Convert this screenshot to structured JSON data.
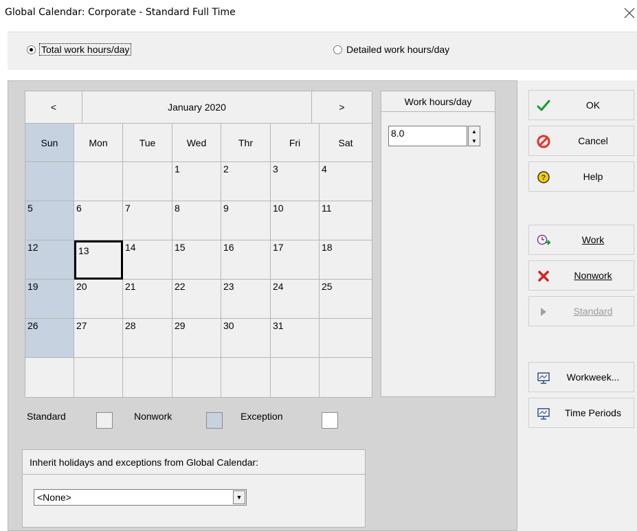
{
  "window": {
    "title": "Global Calendar: Corporate - Standard Full Time"
  },
  "mode": {
    "total_label": "Total work hours/day",
    "detailed_label": "Detailed work hours/day",
    "selected": "total"
  },
  "calendar": {
    "month_label": "January 2020",
    "prev_label": "<",
    "next_label": ">",
    "weekdays": [
      "Sun",
      "Mon",
      "Tue",
      "Wed",
      "Thr",
      "Fri",
      "Sat"
    ],
    "weeks": [
      [
        "",
        "",
        "",
        "1",
        "2",
        "3",
        "4"
      ],
      [
        "5",
        "6",
        "7",
        "8",
        "9",
        "10",
        "11"
      ],
      [
        "12",
        "13",
        "14",
        "15",
        "16",
        "17",
        "18"
      ],
      [
        "19",
        "20",
        "21",
        "22",
        "23",
        "24",
        "25"
      ],
      [
        "26",
        "27",
        "28",
        "29",
        "30",
        "31",
        ""
      ],
      [
        "",
        "",
        "",
        "",
        "",
        "",
        ""
      ]
    ],
    "selected_day": "13"
  },
  "work_hours": {
    "header": "Work hours/day",
    "value": "8.0"
  },
  "legend": {
    "standard": "Standard",
    "nonwork": "Nonwork",
    "exception": "Exception"
  },
  "inherit": {
    "label": "Inherit holidays and exceptions from Global Calendar:",
    "value": "<None>"
  },
  "buttons": {
    "ok": "OK",
    "cancel": "Cancel",
    "help": "Help",
    "work": "Work",
    "nonwork": "Nonwork",
    "standard": "Standard",
    "workweek": "Workweek...",
    "time_periods": "Time Periods"
  },
  "colors": {
    "sunday_fill": "#c6d2df",
    "panel_bg": "#d4d4d4",
    "control_bg": "#f0f0f0",
    "ok_green": "#1a9a2a",
    "cancel_red": "#e8302a",
    "help_yellow": "#f5d000"
  }
}
